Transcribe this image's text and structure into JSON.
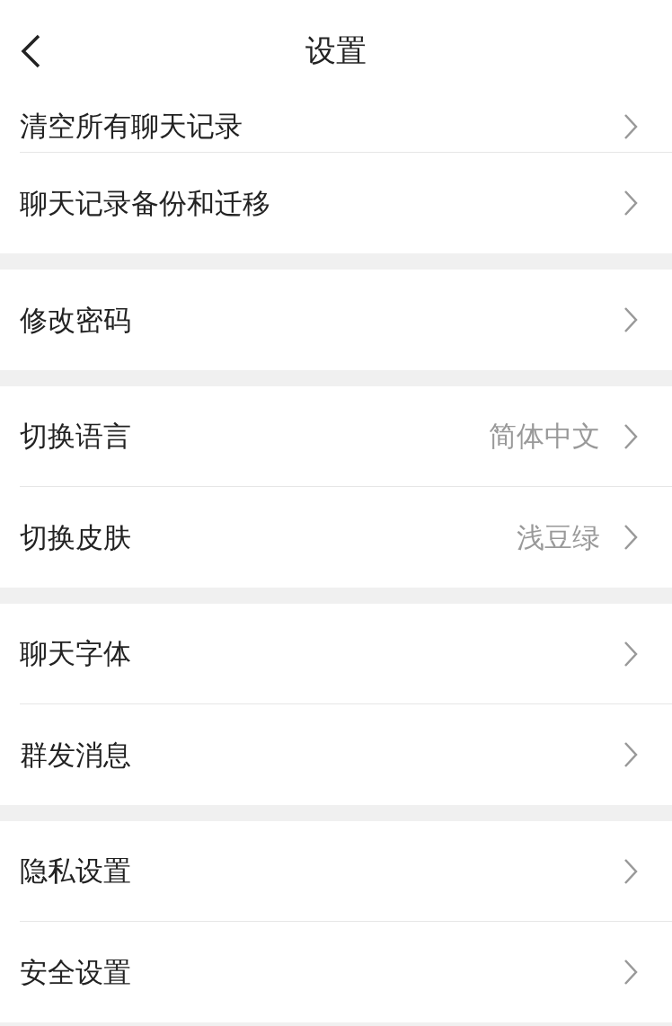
{
  "header": {
    "title": "设置"
  },
  "groups": [
    {
      "items": [
        {
          "label": "清空所有聊天记录"
        },
        {
          "label": "聊天记录备份和迁移"
        }
      ]
    },
    {
      "items": [
        {
          "label": "修改密码"
        }
      ]
    },
    {
      "items": [
        {
          "label": "切换语言",
          "value": "简体中文"
        },
        {
          "label": "切换皮肤",
          "value": "浅豆绿"
        }
      ]
    },
    {
      "items": [
        {
          "label": "聊天字体"
        },
        {
          "label": "群发消息"
        }
      ]
    },
    {
      "items": [
        {
          "label": "隐私设置"
        },
        {
          "label": "安全设置"
        }
      ]
    }
  ]
}
